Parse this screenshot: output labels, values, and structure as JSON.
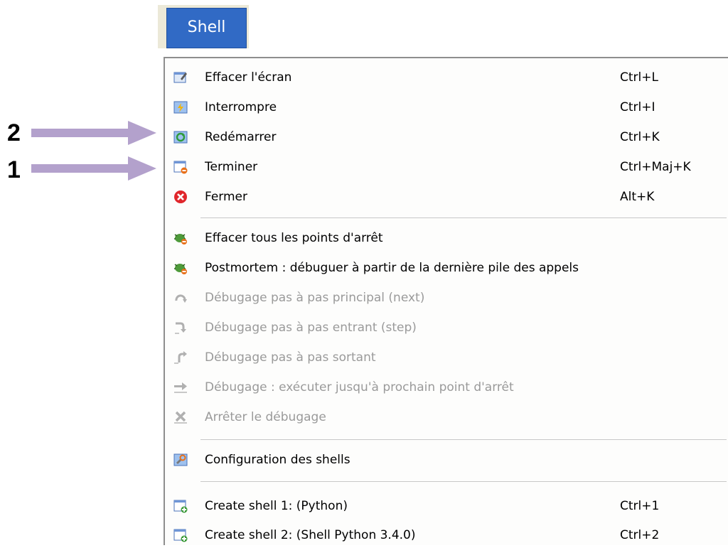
{
  "menubar": {
    "title": "Shell"
  },
  "callouts": [
    {
      "number": "2"
    },
    {
      "number": "1"
    }
  ],
  "menu": {
    "items": [
      {
        "label": "Effacer l'écran",
        "shortcut": "Ctrl+L",
        "icon": "clear-screen-icon"
      },
      {
        "label": "Interrompre",
        "shortcut": "Ctrl+I",
        "icon": "interrupt-icon"
      },
      {
        "label": "Redémarrer",
        "shortcut": "Ctrl+K",
        "icon": "restart-icon"
      },
      {
        "label": "Terminer",
        "shortcut": "Ctrl+Maj+K",
        "icon": "terminate-icon"
      },
      {
        "label": "Fermer",
        "shortcut": "Alt+K",
        "icon": "close-icon"
      },
      {
        "label": "Effacer tous les points d'arrêt",
        "shortcut": "",
        "icon": "bug-clear-icon"
      },
      {
        "label": "Postmortem : débuguer à partir de la dernière pile des appels",
        "shortcut": "",
        "icon": "bug-postmortem-icon"
      },
      {
        "label": "Débugage pas à pas principal (next)",
        "shortcut": "",
        "icon": "step-over-icon",
        "disabled": true
      },
      {
        "label": "Débugage pas à pas entrant (step)",
        "shortcut": "",
        "icon": "step-into-icon",
        "disabled": true
      },
      {
        "label": "Débugage pas à pas sortant",
        "shortcut": "",
        "icon": "step-out-icon",
        "disabled": true
      },
      {
        "label": "Débugage : exécuter jusqu'à prochain point d'arrêt",
        "shortcut": "",
        "icon": "continue-icon",
        "disabled": true
      },
      {
        "label": "Arrêter le débugage",
        "shortcut": "",
        "icon": "stop-debug-icon",
        "disabled": true
      },
      {
        "label": "Configuration des shells",
        "shortcut": "",
        "icon": "shell-config-icon"
      },
      {
        "label": "Create shell 1: (Python)",
        "shortcut": "Ctrl+1",
        "icon": "create-shell-icon"
      },
      {
        "label": "Create shell 2: (Shell Python 3.4.0)",
        "shortcut": "Ctrl+2",
        "icon": "create-shell-icon"
      }
    ]
  },
  "colors": {
    "arrow": "#b3a1cc",
    "menu_highlight": "#316ac5"
  }
}
